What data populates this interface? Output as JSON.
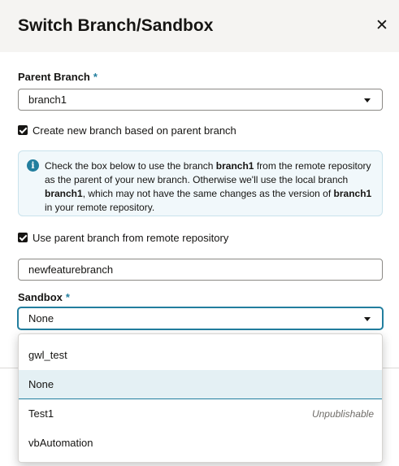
{
  "dialog": {
    "title": "Switch Branch/Sandbox",
    "close_icon": "close-icon",
    "close_glyph": "✕"
  },
  "parent_branch": {
    "label": "Parent Branch",
    "required_mark": "*",
    "value": "branch1"
  },
  "create_branch_checkbox": {
    "checked": true,
    "label": "Create new branch based on parent branch"
  },
  "info_message": {
    "icon": "info-icon",
    "icon_glyph": "i",
    "part1": "Check the box below to use the branch ",
    "branch_a": "branch1",
    "part2": " from the remote repository as the parent of your new branch. Otherwise we'll use the local branch ",
    "branch_b": "branch1",
    "part3": ", which may not have the same changes as the version of ",
    "branch_c": "branch1",
    "part4": " in your remote repository."
  },
  "remote_checkbox": {
    "checked": true,
    "label": "Use parent branch from remote repository"
  },
  "new_branch_input": {
    "value": "newfeaturebranch"
  },
  "sandbox": {
    "label": "Sandbox",
    "required_mark": "*",
    "value": "None",
    "options": [
      {
        "label": "gwl_test",
        "note": ""
      },
      {
        "label": "None",
        "note": "",
        "selected": true
      },
      {
        "label": "Test1",
        "note": "Unpublishable"
      },
      {
        "label": "vbAutomation",
        "note": ""
      }
    ]
  },
  "colors": {
    "accent": "#227e9e",
    "header_bg": "#f5f4f2",
    "info_bg": "#f1f8fb",
    "selected_option_bg": "#e4f0f4"
  }
}
